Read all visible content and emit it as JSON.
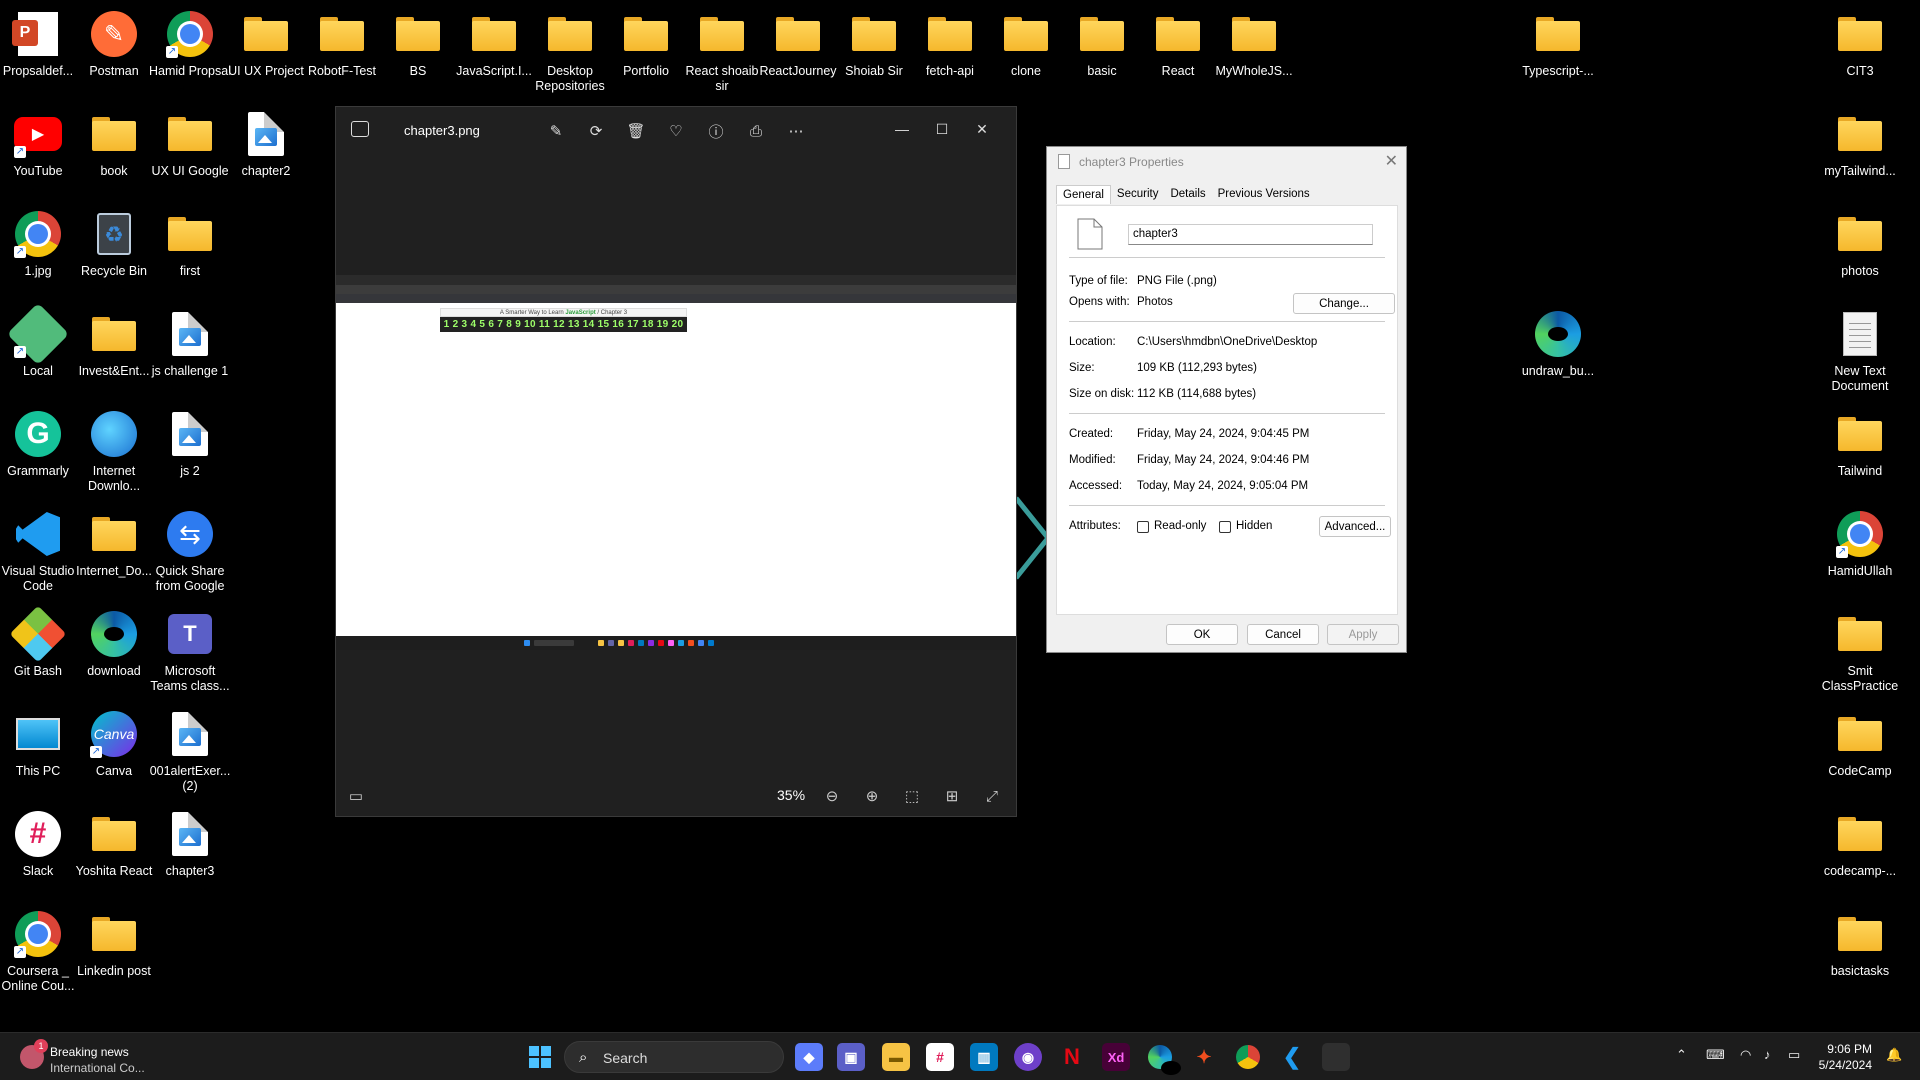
{
  "desktop_icons": [
    {
      "label": "Propsaldef...",
      "type": "pptx",
      "col": 0,
      "row": 0
    },
    {
      "label": "Postman",
      "type": "postman",
      "col": 1,
      "row": 0
    },
    {
      "label": "Hamid Propsal",
      "type": "chrome",
      "col": 2,
      "row": 0
    },
    {
      "label": "UI UX Project",
      "type": "folder",
      "col": 3,
      "row": 0
    },
    {
      "label": "RobotF-Test",
      "type": "folder",
      "col": 4,
      "row": 0
    },
    {
      "label": "BS",
      "type": "folder",
      "col": 5,
      "row": 0
    },
    {
      "label": "JavaScript.I...",
      "type": "folder",
      "col": 6,
      "row": 0
    },
    {
      "label": "Desktop Repositories",
      "type": "folder",
      "col": 7,
      "row": 0
    },
    {
      "label": "Portfolio",
      "type": "folder",
      "col": 8,
      "row": 0
    },
    {
      "label": "React shoaib sir",
      "type": "folder",
      "col": 9,
      "row": 0
    },
    {
      "label": "ReactJourney",
      "type": "folder",
      "col": 10,
      "row": 0
    },
    {
      "label": "Shoiab Sir",
      "type": "folder",
      "col": 11,
      "row": 0
    },
    {
      "label": "fetch-api",
      "type": "folder",
      "col": 12,
      "row": 0
    },
    {
      "label": "clone",
      "type": "folder",
      "col": 13,
      "row": 0
    },
    {
      "label": "basic",
      "type": "folder",
      "col": 14,
      "row": 0
    },
    {
      "label": "React",
      "type": "folder",
      "col": 15,
      "row": 0
    },
    {
      "label": "MyWholeJS...",
      "type": "folder",
      "col": 16,
      "row": 0
    },
    {
      "label": "Typescript-...",
      "type": "folder",
      "col": 20,
      "row": 0
    },
    {
      "label": "CIT3",
      "type": "folder",
      "col": 24,
      "row": 0
    },
    {
      "label": "YouTube",
      "type": "youtube",
      "col": 0,
      "row": 1
    },
    {
      "label": "book",
      "type": "folder",
      "col": 1,
      "row": 1
    },
    {
      "label": "UX UI Google",
      "type": "folder",
      "col": 2,
      "row": 1
    },
    {
      "label": "chapter2",
      "type": "image",
      "col": 3,
      "row": 1
    },
    {
      "label": "myTailwind...",
      "type": "folder",
      "col": 24,
      "row": 1
    },
    {
      "label": "1.jpg",
      "type": "chrome",
      "col": 0,
      "row": 2
    },
    {
      "label": "Recycle Bin",
      "type": "recycle",
      "col": 1,
      "row": 2
    },
    {
      "label": "first",
      "type": "folder",
      "col": 2,
      "row": 2
    },
    {
      "label": "photos",
      "type": "folder",
      "col": 24,
      "row": 2
    },
    {
      "label": "Local",
      "type": "local",
      "col": 0,
      "row": 3
    },
    {
      "label": "Invest&Ent...",
      "type": "folder",
      "col": 1,
      "row": 3
    },
    {
      "label": "js challenge 1",
      "type": "image",
      "col": 2,
      "row": 3
    },
    {
      "label": "undraw_bu...",
      "type": "edge",
      "col": 20,
      "row": 3
    },
    {
      "label": "New Text Document",
      "type": "text",
      "col": 24,
      "row": 3
    },
    {
      "label": "Grammarly",
      "type": "grammarly",
      "col": 0,
      "row": 4
    },
    {
      "label": "Internet Downlo...",
      "type": "idm",
      "col": 1,
      "row": 4
    },
    {
      "label": "js 2",
      "type": "image",
      "col": 2,
      "row": 4
    },
    {
      "label": "Tailwind",
      "type": "folder",
      "col": 24,
      "row": 4
    },
    {
      "label": "Visual Studio Code",
      "type": "vscode",
      "col": 0,
      "row": 5
    },
    {
      "label": "Internet_Do...",
      "type": "folder",
      "col": 1,
      "row": 5
    },
    {
      "label": "Quick Share from Google",
      "type": "quickshare",
      "col": 2,
      "row": 5
    },
    {
      "label": "HamidUllah",
      "type": "chrome",
      "col": 24,
      "row": 5
    },
    {
      "label": "Git Bash",
      "type": "gitbash",
      "col": 0,
      "row": 6
    },
    {
      "label": "download",
      "type": "edge",
      "col": 1,
      "row": 6
    },
    {
      "label": "Microsoft Teams class...",
      "type": "teams",
      "col": 2,
      "row": 6
    },
    {
      "label": "Smit ClassPractice",
      "type": "folder",
      "col": 24,
      "row": 6
    },
    {
      "label": "This PC",
      "type": "thispc",
      "col": 0,
      "row": 7
    },
    {
      "label": "Canva",
      "type": "canva",
      "col": 1,
      "row": 7
    },
    {
      "label": "001alertExer... (2)",
      "type": "image",
      "col": 2,
      "row": 7
    },
    {
      "label": "CodeCamp",
      "type": "folder",
      "col": 24,
      "row": 7
    },
    {
      "label": "Slack",
      "type": "slack",
      "col": 0,
      "row": 8
    },
    {
      "label": "Yoshita React",
      "type": "folder",
      "col": 1,
      "row": 8
    },
    {
      "label": "chapter3",
      "type": "image",
      "col": 2,
      "row": 8
    },
    {
      "label": "codecamp-...",
      "type": "folder",
      "col": 24,
      "row": 8
    },
    {
      "label": "Coursera _ Online Cou...",
      "type": "chrome",
      "col": 0,
      "row": 9
    },
    {
      "label": "Linkedin post",
      "type": "folder",
      "col": 1,
      "row": 9
    },
    {
      "label": "basictasks",
      "type": "folder",
      "col": 24,
      "row": 9
    }
  ],
  "photos_window": {
    "filename": "chapter3.png",
    "zoom": "35%",
    "toolbar_icons": [
      "edit-icon",
      "rotate-icon",
      "delete-icon",
      "favorite-icon",
      "info-icon",
      "print-icon",
      "more-icon"
    ],
    "image": {
      "heading_prefix": "A Smarter Way to Learn ",
      "heading_js": "JavaScript",
      "heading_suffix": " / Chapter 3",
      "chapters": "1 2 3 4 5 6 7 8 9 10 11 12 13 14 15 16 17 18 19 20"
    }
  },
  "properties_dialog": {
    "title": "chapter3 Properties",
    "tabs": [
      "General",
      "Security",
      "Details",
      "Previous Versions"
    ],
    "file_name": "chapter3",
    "type_label": "Type of file:",
    "type_value": "PNG File (.png)",
    "opens_label": "Opens with:",
    "opens_value": "Photos",
    "change_button": "Change...",
    "location_label": "Location:",
    "location_value": "C:\\Users\\hmdbn\\OneDrive\\Desktop",
    "size_label": "Size:",
    "size_value": "109 KB (112,293 bytes)",
    "size_disk_label": "Size on disk:",
    "size_disk_value": "112 KB (114,688 bytes)",
    "created_label": "Created:",
    "created_value": "Friday, May 24, 2024, 9:04:45 PM",
    "modified_label": "Modified:",
    "modified_value": "Friday, May 24, 2024, 9:04:46 PM",
    "accessed_label": "Accessed:",
    "accessed_value": "Today, May 24, 2024, 9:05:04 PM",
    "attributes_label": "Attributes:",
    "readonly_label": "Read-only",
    "hidden_label": "Hidden",
    "advanced_button": "Advanced...",
    "ok_button": "OK",
    "cancel_button": "Cancel",
    "apply_button": "Apply"
  },
  "taskbar": {
    "news_title": "Breaking news",
    "news_subtitle": "International Co...",
    "news_badge": "1",
    "search_placeholder": "Search",
    "time": "9:06 PM",
    "date": "5/24/2024"
  }
}
